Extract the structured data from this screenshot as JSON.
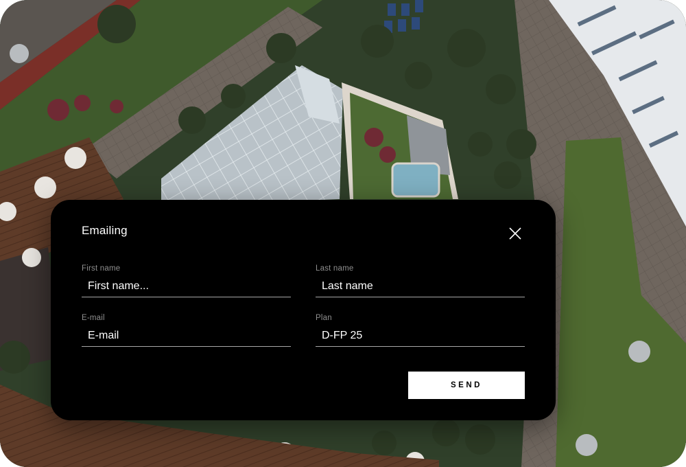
{
  "dialog": {
    "title": "Emailing",
    "close_icon": "close-icon",
    "fields": {
      "first_name": {
        "label": "First name",
        "placeholder": "First name...",
        "value": ""
      },
      "last_name": {
        "label": "Last name",
        "placeholder": "Last name",
        "value": ""
      },
      "email": {
        "label": "E-mail",
        "placeholder": "E-mail",
        "value": ""
      },
      "plan": {
        "label": "Plan",
        "placeholder": "",
        "value": "D-FP 25"
      }
    },
    "send_label": "SEND"
  },
  "colors": {
    "dialog_bg": "#000000",
    "button_bg": "#ffffff",
    "label": "#8f8f8f",
    "underline": "#a8a8a8"
  }
}
